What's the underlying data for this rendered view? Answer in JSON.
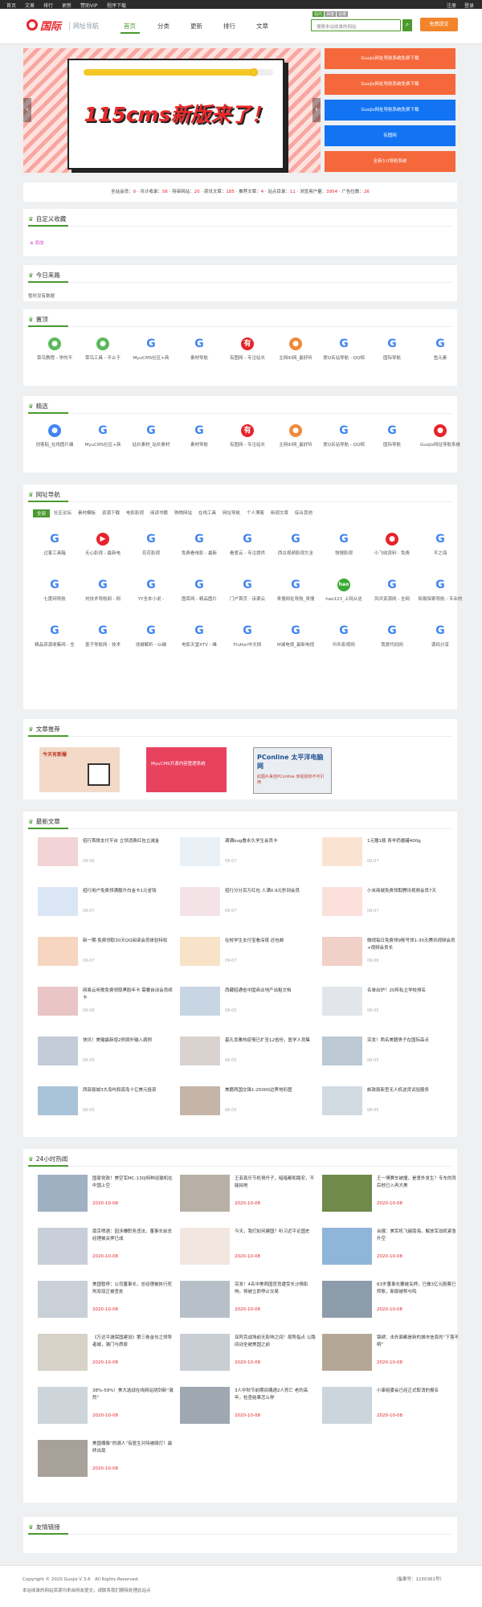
{
  "topbar": {
    "left_links": [
      "首页",
      "文章",
      "排行",
      "更新",
      "赞助VIP",
      "程序下载"
    ],
    "right_links": [
      "注册",
      "登录"
    ]
  },
  "header": {
    "logo_text": "国际",
    "logo_sub": "网址导航",
    "nav": [
      "首页",
      "分类",
      "更新",
      "排行",
      "文章"
    ],
    "search_tabs": [
      "站内",
      "百度",
      "谷歌"
    ],
    "search_placeholder": "搜索本站收录的网站",
    "submit_label": "免费提交",
    "search_icon": "search-icon"
  },
  "banner": {
    "headline": "115cms新版来了！",
    "progress": 0.9,
    "promos": [
      {
        "label": "Guojiz网址导航系统免费下载",
        "color": "#f5683b"
      },
      {
        "label": "Guojiz网址导航系统免费下载",
        "color": "#f5683b"
      },
      {
        "label": "Guojiz网址导航系统免费下载",
        "color": "#1274f3"
      },
      {
        "label": "有图网",
        "color": "#1274f3"
      },
      {
        "label": "全新3.0导航系统",
        "color": "#f5683b"
      }
    ]
  },
  "stats": {
    "members_label": "全站会员：",
    "members": "0",
    "total_label": "共计收录：",
    "total": "56",
    "pending_label": "待审网站：",
    "pending": "20",
    "news_label": "资讯文章：",
    "news": "185",
    "recommend_label": "推荐文章：",
    "recommend": "4",
    "cats_label": "站点目录：",
    "cats": "11",
    "views_label": "浏览用户量：",
    "views": "3954",
    "ads_label": "广告位数：",
    "ads": "26"
  },
  "custom": {
    "title": "自定义收藏",
    "add_label": "添加"
  },
  "today": {
    "title": "今日来路",
    "empty": "暂时没有数据"
  },
  "top_sites": {
    "title": "置顶",
    "items": [
      {
        "label": "菜鸟教程 - 学的不",
        "icon": "robot-icon",
        "color": "#5cb85c"
      },
      {
        "label": "菜鸟工具 - 不止于",
        "icon": "robot-icon",
        "color": "#5cb85c"
      },
      {
        "label": "MyuCMS社区+商",
        "icon": "google-icon",
        "color": "#4285f4"
      },
      {
        "label": "素材导航",
        "icon": "google-icon",
        "color": "#4285f4"
      },
      {
        "label": "有图网 - 专注站长",
        "icon": "you-icon",
        "color": "#e6242b"
      },
      {
        "label": "主网ID网_最好听",
        "icon": "lion-icon",
        "color": "#f08a3a"
      },
      {
        "label": "爱Q名站导航 - QQ相",
        "icon": "google-icon",
        "color": "#4285f4"
      },
      {
        "label": "国际导航",
        "icon": "google-icon",
        "color": "#4285f4"
      },
      {
        "label": "鱼元素",
        "icon": "google-icon",
        "color": "#4285f4"
      }
    ]
  },
  "featured": {
    "title": "精选",
    "items": [
      {
        "label": "创客贴_在线图片编",
        "icon": "chuangke-icon",
        "color": "#4285f4"
      },
      {
        "label": "MyuCMS社区+商",
        "icon": "google-icon",
        "color": "#4285f4"
      },
      {
        "label": "站长素材_站长素材",
        "icon": "google-icon",
        "color": "#4285f4"
      },
      {
        "label": "素材导航",
        "icon": "google-icon",
        "color": "#4285f4"
      },
      {
        "label": "有图网 - 专注站长",
        "icon": "you-icon",
        "color": "#e6242b"
      },
      {
        "label": "主网ID网_最好听",
        "icon": "lion-icon",
        "color": "#f08a3a"
      },
      {
        "label": "爱Q名站导航 - QQ相",
        "icon": "google-icon",
        "color": "#4285f4"
      },
      {
        "label": "国际导航",
        "icon": "google-icon",
        "color": "#4285f4"
      },
      {
        "label": "Guojiz网址导航系统",
        "icon": "guojiz-icon",
        "color": "#e6242b"
      }
    ]
  },
  "directory": {
    "title": "网址导航",
    "tabs": [
      "全部",
      "社区论坛",
      "素材模板",
      "资源下载",
      "电影影视",
      "阅读书籍",
      "购物网站",
      "在线工具",
      "网址导航",
      "个人博客",
      "新闻文章",
      "综合其他"
    ],
    "items": [
      {
        "label": "过客工具箱",
        "icon": "google-icon",
        "color": "#4285f4"
      },
      {
        "label": "无心影视 - 最新电",
        "icon": "play-icon",
        "color": "#e6242b"
      },
      {
        "label": "花花影视",
        "icon": "google-icon",
        "color": "#4285f4"
      },
      {
        "label": "免费看电影 - 最新",
        "icon": "google-icon",
        "color": "#4285f4"
      },
      {
        "label": "看爱云 - 专注提供",
        "icon": "google-icon",
        "color": "#4285f4"
      },
      {
        "label": "西瓜视频影视大全",
        "icon": "google-icon",
        "color": "#4285f4"
      },
      {
        "label": "快搜影视",
        "icon": "google-icon",
        "color": "#4285f4"
      },
      {
        "label": "小飞收资料 - 免费",
        "icon": "bird-icon",
        "color": "#e6242b"
      },
      {
        "label": "平之海",
        "icon": "google-icon",
        "color": "#4285f4"
      },
      {
        "label": "七度网导航",
        "icon": "google-icon",
        "color": "#4285f4"
      },
      {
        "label": "刘技术导航网 - 网",
        "icon": "google-icon",
        "color": "#4285f4"
      },
      {
        "label": "YY全本小说 -",
        "icon": "google-icon",
        "color": "#4285f4"
      },
      {
        "label": "图库网 - 精品图片",
        "icon": "google-icon",
        "color": "#4285f4"
      },
      {
        "label": "门户首页 - 诉渠云",
        "icon": "google-icon",
        "color": "#4285f4"
      },
      {
        "label": "来搜网址导航_来搜",
        "icon": "google-icon",
        "color": "#4285f4"
      },
      {
        "label": "hao123_上网从这",
        "icon": "hao-icon",
        "color": "#3aa935"
      },
      {
        "label": "风兵资源网 - 全网",
        "icon": "google-icon",
        "color": "#4285f4"
      },
      {
        "label": "网易探索导航 - 专业的",
        "icon": "google-icon",
        "color": "#4285f4"
      },
      {
        "label": "精品资源收集网 - 全",
        "icon": "google-icon",
        "color": "#4285f4"
      },
      {
        "label": "墨子导航网 - 技术",
        "icon": "google-icon",
        "color": "#4285f4"
      },
      {
        "label": "池城解析 - Gi破",
        "icon": "google-icon",
        "color": "#4285f4"
      },
      {
        "label": "电影天堂XTV - 峰",
        "icon": "google-icon",
        "color": "#4285f4"
      },
      {
        "label": "Flutter中文网",
        "icon": "google-icon",
        "color": "#4285f4"
      },
      {
        "label": "M减电视_最新电视",
        "icon": "google-icon",
        "color": "#4285f4"
      },
      {
        "label": "叭叭影视网",
        "icon": "google-icon",
        "color": "#4285f4"
      },
      {
        "label": "我爱代码网",
        "icon": "google-icon",
        "color": "#4285f4"
      },
      {
        "label": "源码分享",
        "icon": "google-icon",
        "color": "#4285f4"
      }
    ]
  },
  "ads": {
    "title": "文章推荐",
    "items": [
      {
        "label": "今天有新爆",
        "color": "#f3d9c7"
      },
      {
        "label": "MyuCMS开源内容管理系统",
        "color": "#e8425f"
      },
      {
        "label": "PConline 太平洋电脑网",
        "sub": "此图片来自PConline 未经授权不可引用",
        "color": "#eaeef3"
      }
    ]
  },
  "latest": {
    "title": "最新文章",
    "items": [
      {
        "title": "招行首拨支付平台 立领消费红包立减金",
        "date": "09-06",
        "color": "#f2d3d6"
      },
      {
        "title": "满满bug叠永久学生会员卡",
        "date": "09-07",
        "color": "#e9f0f6"
      },
      {
        "title": "1元赠1瓶 青羊奶酱罐400g",
        "date": "09-07",
        "color": "#fbe3d2"
      },
      {
        "title": "招行用户免费领满额升白金卡1元省钱",
        "date": "09-07",
        "color": "#dbe6f5"
      },
      {
        "title": "招行分分百万红包 人满0.9元秒到会员",
        "date": "09-07",
        "color": "#f3e2e6"
      },
      {
        "title": "小米商城免费领取腾讯视频会员7天",
        "date": "09-07",
        "color": "#fbe0db"
      },
      {
        "title": "新一期·免费领取30天QQ阅读会员体验特权",
        "date": "09-07",
        "color": "#f6d6c1"
      },
      {
        "title": "在校学生支付宝看深夜 还包邮",
        "date": "09-07",
        "color": "#f8e3c8"
      },
      {
        "title": "微视每日免费领9账号领1-30天腾讯视频会员+视频会员长",
        "date": "09-06",
        "color": "#f1d0c8"
      },
      {
        "title": "网易云听歌免费领取黑胶年卡 需要自动会员续卡",
        "date": "09-06",
        "color": "#e9c5c5"
      },
      {
        "title": "西藏昭通省中国商业地产出租文档",
        "date": "08-05",
        "color": "#c8d5e2"
      },
      {
        "title": "名单出炉！20所私立学校排名",
        "date": "08-05",
        "color": "#e2e6ea"
      },
      {
        "title": "快讯！美输赢新增2例境外输入病例",
        "date": "08-05",
        "color": "#c3ccd8"
      },
      {
        "title": "基孔肯雅热疫情已扩至12省份，医学人员集",
        "date": "08-05",
        "color": "#d9d2cf"
      },
      {
        "title": "突发！两名美籍男子在国际高点",
        "date": "08-05",
        "color": "#bcc8d4"
      },
      {
        "title": "西部县城3大岛屿和孤岛十亿美元投资",
        "date": "08-05",
        "color": "#a9c3d9"
      },
      {
        "title": "美籍两国交锋1:25000边界地形图",
        "date": "08-05",
        "color": "#c5b5a8"
      },
      {
        "title": "邮政局新型无人机送货试验服务",
        "date": "08-05",
        "color": "#d2dae2"
      }
    ]
  },
  "hot24": {
    "title": "24小时热闻",
    "items": [
      {
        "title": "国家党政！美空军MC-130J特种运输机在中国上空",
        "date": "2020-10-08",
        "color": "#9fb0c2"
      },
      {
        "title": "王菲真乐节机哥丹子，暗暗都和路安，不能拍地",
        "date": "2020-10-08",
        "color": "#b8b0a6"
      },
      {
        "title": "王一博赛车被撞，是意外发生？专车的背后他已入冉大美",
        "date": "2020-10-08",
        "color": "#6f8a4a"
      },
      {
        "title": "南京喷酒：因涉嫌职务违法，董事长前总经理被关押已成",
        "date": "2020-10-08",
        "color": "#c8cfd8"
      },
      {
        "title": "今天，我们如何建国？听习近平论国史",
        "date": "2020-10-08",
        "color": "#f1e7e0"
      },
      {
        "title": "台媒：美军机飞越南海，解放军战机紧急升空",
        "date": "2020-10-08",
        "color": "#8fb6d9"
      },
      {
        "title": "美国暂停：公司董事长，总经理被执行死刑双双正被查处",
        "date": "2020-10-08",
        "color": "#c9d0d8"
      },
      {
        "title": "突发！4名中美两国官员遭受长沙情影响，将被立即停止交易",
        "date": "2020-10-08",
        "color": "#b7c0c8"
      },
      {
        "title": "63岁董事长要被关押，已做3亿元股票已转账，新版被称与鸣",
        "date": "2020-10-08",
        "color": "#8d9caa"
      },
      {
        "title": "《万达平城保国建设》第三卷金句之领导者城，澳门与质原",
        "date": "2020-10-08",
        "color": "#d6d2c8"
      },
      {
        "title": "亚阿克战场前无影响之间！局势指点 公路间动全被美国之前",
        "date": "2020-10-08",
        "color": "#c9ced4"
      },
      {
        "title": "锦绣：击外面都是新的城市信息的“下落不明”",
        "date": "2020-10-08",
        "color": "#b5a795"
      },
      {
        "title": "38%-59%！美大选战在线网站测剑新“激烈”",
        "date": "2020-10-08",
        "color": "#cdd4da"
      },
      {
        "title": "3人中秋节前期间偶遇2人死亡 老的高年，检查结果怎么样",
        "date": "2020-10-08",
        "color": "#9fa7b1"
      },
      {
        "title": "小康组委会已经正式取消的报名",
        "date": "2020-10-08",
        "color": "#ccd4dc"
      },
      {
        "title": "美国偶像“的骑人”有医生对待被殴打！最终出现",
        "date": "2020-10-08",
        "color": "#a7a19a"
      }
    ]
  },
  "friends": {
    "title": "友情链接"
  },
  "footer": {
    "copyright": "Copyright © 2020 Guojiz V 3.6　All Rights Reserved.",
    "disclaimer": "本站收录的网站资源均来自网友提交，请联系我们删除处理此站点",
    "icp": "（备案号：1150361号）"
  }
}
